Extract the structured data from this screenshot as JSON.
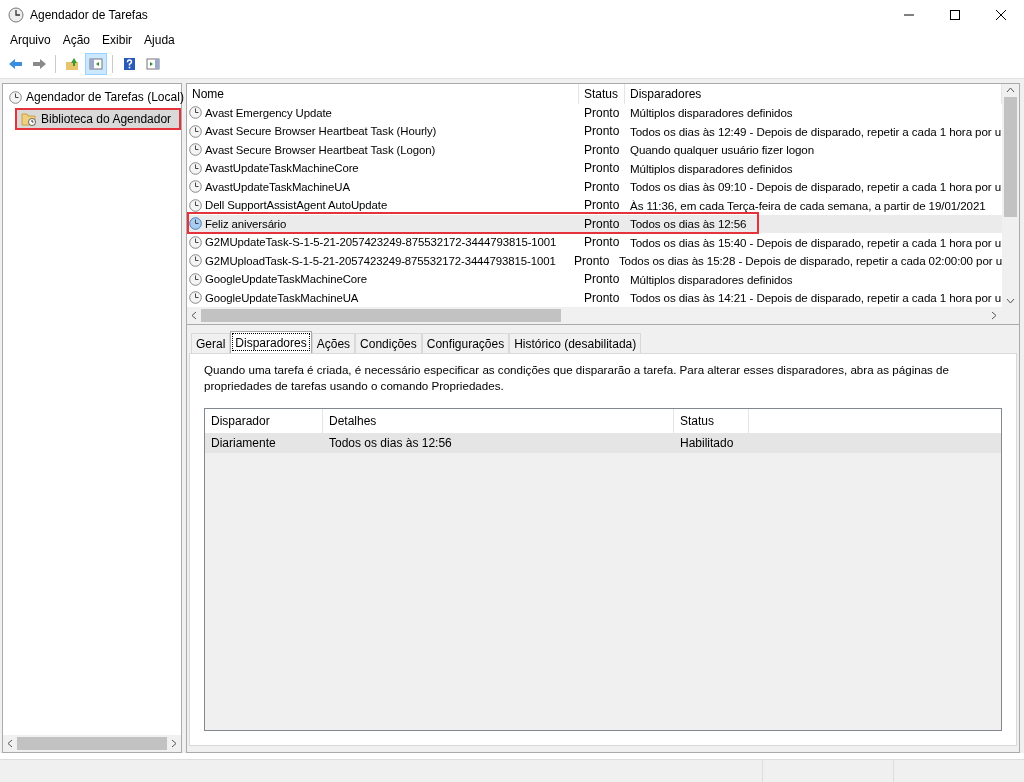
{
  "window": {
    "title": "Agendador de Tarefas"
  },
  "menu": [
    "Arquivo",
    "Ação",
    "Exibir",
    "Ajuda"
  ],
  "toolbar": [
    {
      "kind": "back",
      "pressed": false
    },
    {
      "kind": "forward",
      "pressed": false
    },
    {
      "kind": "up",
      "pressed": false
    },
    {
      "kind": "tree",
      "pressed": true
    },
    {
      "kind": "help",
      "pressed": false
    },
    {
      "kind": "pane",
      "pressed": false
    }
  ],
  "tree": [
    {
      "label": "Agendador de Tarefas (Local)",
      "selected": false,
      "highlighted": false,
      "children": [
        {
          "label": "Biblioteca do Agendador",
          "selected": true,
          "highlighted": true
        }
      ]
    }
  ],
  "tasks": {
    "columns": [
      "Nome",
      "Status",
      "Disparadores"
    ],
    "rows": [
      {
        "name": "Avast Emergency Update",
        "status": "Pronto",
        "triggers": "Múltiplos disparadores definidos",
        "selected": false,
        "highlighted": false
      },
      {
        "name": "Avast Secure Browser Heartbeat Task (Hourly)",
        "status": "Pronto",
        "triggers": "Todos os dias às 12:49 - Depois de disparado, repetir a cada 1 hora por u",
        "selected": false,
        "highlighted": false
      },
      {
        "name": "Avast Secure Browser Heartbeat Task (Logon)",
        "status": "Pronto",
        "triggers": "Quando qualquer usuário fizer logon",
        "selected": false,
        "highlighted": false
      },
      {
        "name": "AvastUpdateTaskMachineCore",
        "status": "Pronto",
        "triggers": "Múltiplos disparadores definidos",
        "selected": false,
        "highlighted": false
      },
      {
        "name": "AvastUpdateTaskMachineUA",
        "status": "Pronto",
        "triggers": "Todos os dias às 09:10 - Depois de disparado, repetir a cada 1 hora por u",
        "selected": false,
        "highlighted": false
      },
      {
        "name": "Dell SupportAssistAgent AutoUpdate",
        "status": "Pronto",
        "triggers": "Às 11:36, em cada Terça-feira de cada semana, a partir de 19/01/2021",
        "selected": false,
        "highlighted": false
      },
      {
        "name": "Feliz aniversário",
        "status": "Pronto",
        "triggers": "Todos os dias às 12:56",
        "selected": true,
        "highlighted": true
      },
      {
        "name": "G2MUpdateTask-S-1-5-21-2057423249-875532172-3444793815-1001",
        "status": "Pronto",
        "triggers": "Todos os dias às 15:40 - Depois de disparado, repetir a cada 1 hora por u",
        "selected": false,
        "highlighted": false
      },
      {
        "name": "G2MUploadTask-S-1-5-21-2057423249-875532172-3444793815-1001",
        "status": "Pronto",
        "triggers": "Todos os dias às 15:28 - Depois de disparado, repetir a cada 02:00:00 por u",
        "selected": false,
        "highlighted": false
      },
      {
        "name": "GoogleUpdateTaskMachineCore",
        "status": "Pronto",
        "triggers": "Múltiplos disparadores definidos",
        "selected": false,
        "highlighted": false
      },
      {
        "name": "GoogleUpdateTaskMachineUA",
        "status": "Pronto",
        "triggers": "Todos os dias às 14:21 - Depois de disparado, repetir a cada 1 hora por u",
        "selected": false,
        "highlighted": false
      }
    ]
  },
  "tabs": [
    {
      "label": "Geral",
      "selected": false
    },
    {
      "label": "Disparadores",
      "selected": true
    },
    {
      "label": "Ações",
      "selected": false
    },
    {
      "label": "Condições",
      "selected": false
    },
    {
      "label": "Configurações",
      "selected": false
    },
    {
      "label": "Histórico (desabilitada)",
      "selected": false
    }
  ],
  "description": "Quando uma tarefa é criada, é necessário especificar as condições que dispararão a tarefa. Para alterar esses disparadores, abra as páginas de propriedades de tarefas usando o comando Propriedades.",
  "triggers": {
    "columns": [
      "Disparador",
      "Detalhes",
      "Status"
    ],
    "rows": [
      {
        "cells": [
          "Diariamente",
          "Todos os dias às 12:56",
          "Habilitado"
        ],
        "selected": true
      }
    ]
  }
}
